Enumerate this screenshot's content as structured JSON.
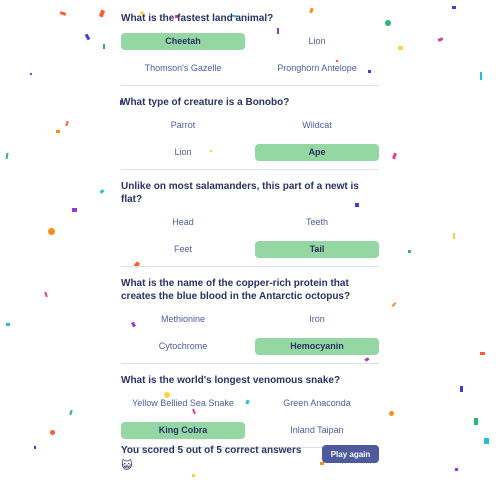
{
  "questions": [
    {
      "text": "What is the fastest land animal?",
      "answers": [
        {
          "label": "Cheetah",
          "state": "correct"
        },
        {
          "label": "Lion",
          "state": "neutral"
        },
        {
          "label": "Thomson's Gazelle",
          "state": "neutral"
        },
        {
          "label": "Pronghorn Antelope",
          "state": "neutral"
        }
      ]
    },
    {
      "text": "What type of creature is a Bonobo?",
      "answers": [
        {
          "label": "Parrot",
          "state": "neutral"
        },
        {
          "label": "Wildcat",
          "state": "neutral"
        },
        {
          "label": "Lion",
          "state": "neutral"
        },
        {
          "label": "Ape",
          "state": "correct"
        }
      ]
    },
    {
      "text": "Unlike on most salamanders, this part of a newt is flat?",
      "answers": [
        {
          "label": "Head",
          "state": "neutral"
        },
        {
          "label": "Teeth",
          "state": "neutral"
        },
        {
          "label": "Feet",
          "state": "neutral"
        },
        {
          "label": "Tail",
          "state": "correct"
        }
      ]
    },
    {
      "text": "What is the name of the copper-rich protein that creates the blue blood in the Antarctic octopus?",
      "answers": [
        {
          "label": "Methionine",
          "state": "neutral"
        },
        {
          "label": "Iron",
          "state": "neutral"
        },
        {
          "label": "Cytochrome",
          "state": "neutral"
        },
        {
          "label": "Hemocyanin",
          "state": "correct"
        }
      ]
    },
    {
      "text": "What is the world's longest venomous snake?",
      "answers": [
        {
          "label": "Yellow Bellied Sea Snake",
          "state": "neutral"
        },
        {
          "label": "Green Anaconda",
          "state": "neutral"
        },
        {
          "label": "King Cobra",
          "state": "correct"
        },
        {
          "label": "Inland Taipan",
          "state": "neutral"
        }
      ]
    }
  ],
  "footer": {
    "score_text": "You scored 5 out of 5 correct answers",
    "emoji": "😺",
    "play_again_label": "Play again"
  },
  "colors": {
    "correct": "#94d7a2",
    "button": "#4d5b9e",
    "text": "#293264",
    "confetti": [
      "#ff5a36",
      "#3b3fd8",
      "#2bb673",
      "#ffd23f",
      "#e8398f",
      "#1ec1d7",
      "#9b36d6",
      "#ff8c1a"
    ]
  }
}
